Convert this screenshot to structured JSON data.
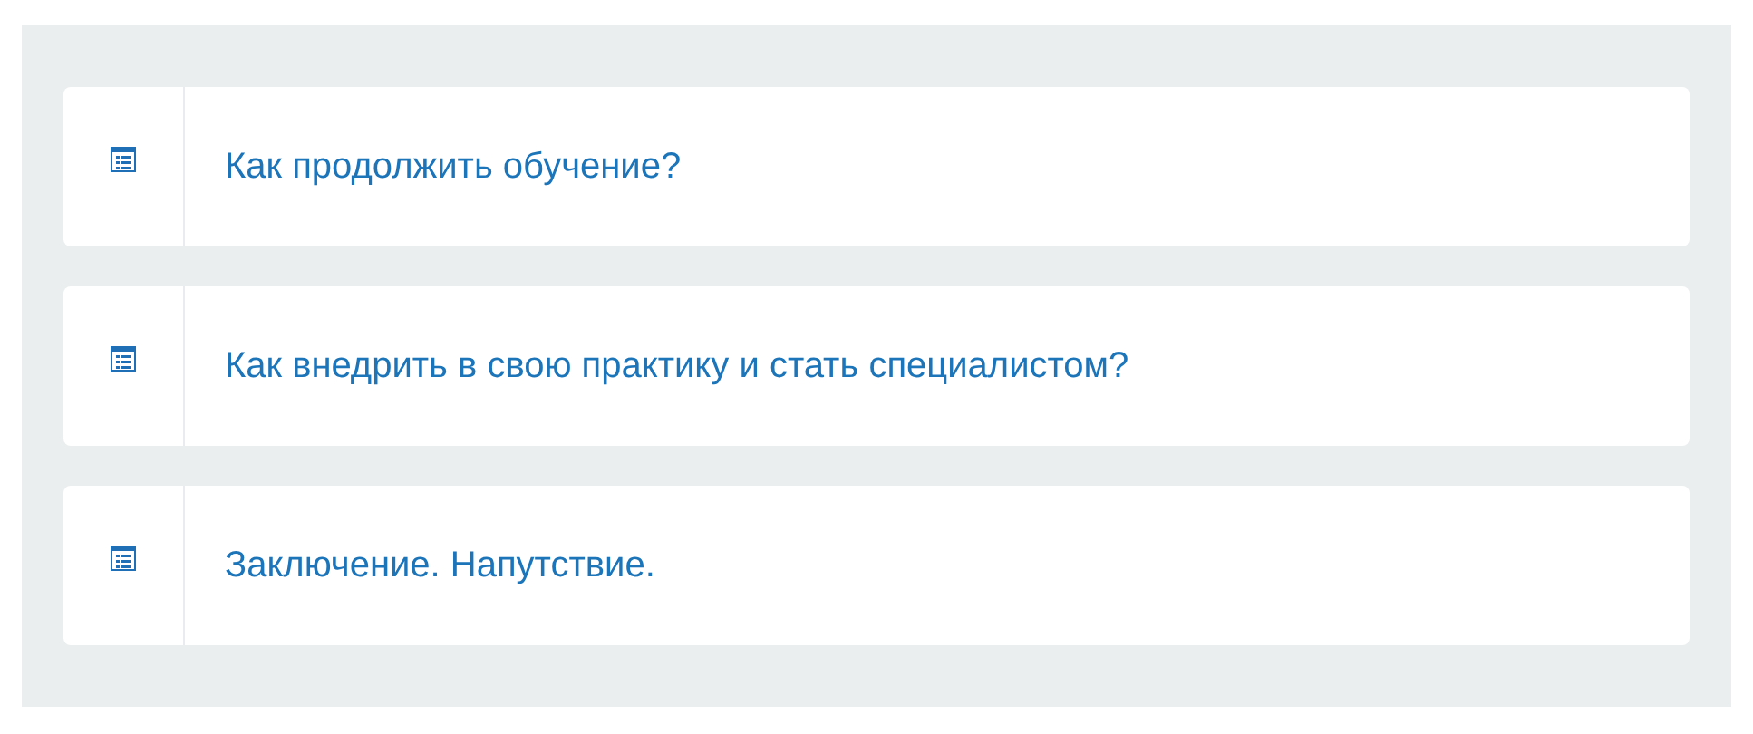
{
  "lessons": [
    {
      "title": "Как продолжить обучение?"
    },
    {
      "title": "Как внедрить в свою практику и стать специалистом?"
    },
    {
      "title": "Заключение. Напутствие."
    }
  ]
}
